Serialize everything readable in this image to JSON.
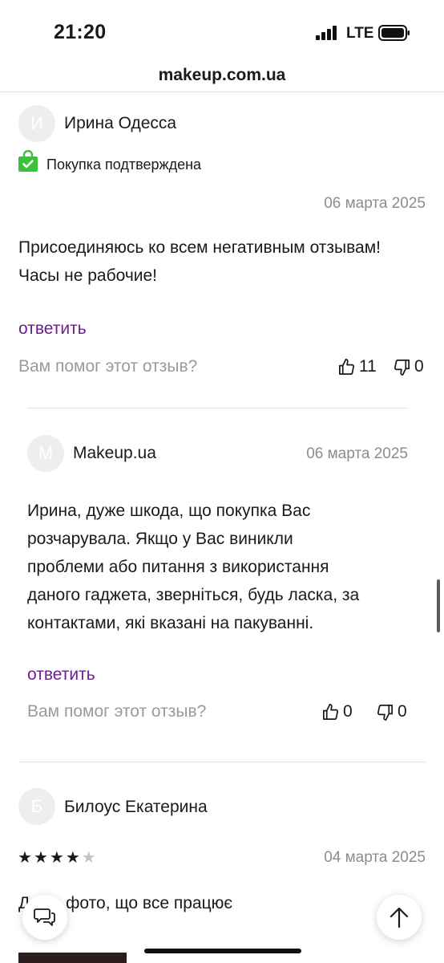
{
  "status_bar": {
    "time": "21:20",
    "network": "LTE"
  },
  "browser": {
    "url": "makeup.com.ua"
  },
  "review1": {
    "avatar_letter": "И",
    "author": "Ирина Одесса",
    "verified": "Покупка подтверждена",
    "date": "06 марта 2025",
    "text_line1": "Присоединяюсь ко всем негативным отзывам!",
    "text_line2": "Часы не рабочие!",
    "reply": "ответить",
    "helpful": "Вам помог этот отзыв?",
    "likes": "11",
    "dislikes": "0"
  },
  "shop_reply": {
    "avatar_letter": "M",
    "author": "Makeup.ua",
    "date": "06 марта 2025",
    "text_line1": "Ирина, дуже шкода, що покупка Вас",
    "text_line2": "розчарувала. Якщо у Вас виникли",
    "text_line3": "проблеми або питання з використання",
    "text_line4": "даного гаджета, зверніться, будь ласка, за",
    "text_line5": "контактами, які вказані на пакуванні.",
    "reply": "ответить",
    "helpful": "Вам помог этот отзыв?",
    "likes": "0",
    "dislikes": "0"
  },
  "review2": {
    "avatar_letter": "Б",
    "author": "Билоус Екатерина",
    "rating": 4,
    "rating_max": 5,
    "date": "04 марта 2025",
    "text_partial": "Д    ю фото, що все працює"
  },
  "colors": {
    "accent_link": "#6b1f8f",
    "verified_green": "#3cc13b",
    "muted_text": "#8c8c8c",
    "avatar_bg": "#eeeeee"
  },
  "icons": {
    "verified": "shopping-bag-check-icon",
    "like": "thumbs-up-icon",
    "dislike": "thumbs-down-icon",
    "chat": "chat-icon",
    "scroll_top": "arrow-up-icon"
  }
}
